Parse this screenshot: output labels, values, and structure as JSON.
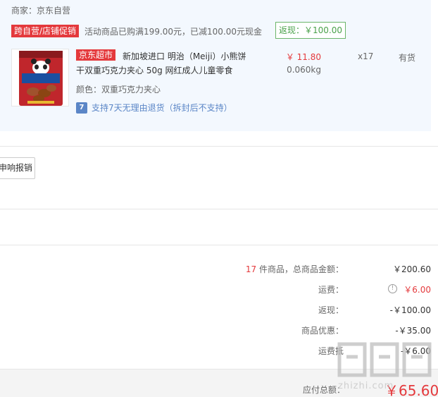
{
  "merchant": "商家：京东自营",
  "promo": {
    "tag": "跨自营/店铺促销",
    "text": "活动商品已购满199.00元，已减100.00元现金",
    "rebate": "返现：￥100.00"
  },
  "item": {
    "tag": "京东超市",
    "title_line1": "新加坡进口 明治（Meiji）小熊饼",
    "title_line2": "干双重巧克力夹心 50g 网红成人儿童零食",
    "price": "￥ 11.80",
    "weight": "0.060kg",
    "quantity": "x17",
    "stock": "有货",
    "color": "颜色：双重巧克力夹心",
    "return_icon": "7",
    "return_policy": "支持7天无理由退货（拆封后不支持）",
    "image_text": "HELLO PANDA"
  },
  "reimburse_button": "申响报销",
  "summary": {
    "count": "17",
    "count_label": "件商品，总商品金额：",
    "total_goods": "￥200.60",
    "shipping_label": "运费：",
    "shipping": "￥6.00",
    "rebate_label": "返现：",
    "rebate": "-￥100.00",
    "discount_label": "商品优惠：",
    "discount": "-￥35.00",
    "shipping_discount_label": "运费抵",
    "shipping_discount": "-￥6.00"
  },
  "total": {
    "label": "应付总额：",
    "value": "￥65.60"
  },
  "watermark": {
    "text": "zhizhi.com"
  },
  "colors": {
    "accent_red": "#e4393c",
    "rebate_green": "#4aa14a",
    "block_bg": "#f3f8fe",
    "return_blue": "#5b86c7"
  }
}
